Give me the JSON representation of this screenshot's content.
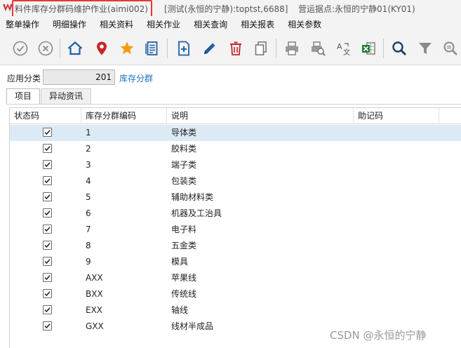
{
  "window": {
    "title": "料件库存分群码维护作业(aimi002)",
    "connection": "[测试(永恒的宁静):toptst,6688]",
    "site": "营运据点:永恒的宁静01(KY01)"
  },
  "menu": {
    "items": [
      {
        "label": "整单操作"
      },
      {
        "label": "明细操作"
      },
      {
        "label": "相关资料"
      },
      {
        "label": "相关作业"
      },
      {
        "label": "相关查询"
      },
      {
        "label": "相关报表"
      },
      {
        "label": "相关参数"
      }
    ]
  },
  "toolbar": {
    "icons": [
      "confirm-icon",
      "cancel-icon",
      "home-icon",
      "location-icon",
      "favorite-icon",
      "list-icon",
      "add-icon",
      "edit-icon",
      "delete-icon",
      "copy-icon",
      "print-icon",
      "print-preview-icon",
      "translate-icon",
      "excel-icon",
      "search-icon",
      "filter-icon",
      "advanced-search-icon"
    ]
  },
  "category": {
    "label": "应用分类",
    "value": "201",
    "link": "库存分群"
  },
  "tabs": [
    {
      "label": "项目",
      "active": true
    },
    {
      "label": "异动资讯",
      "active": false
    }
  ],
  "grid": {
    "columns": [
      "状态码",
      "库存分群编码",
      "说明",
      "助记码"
    ],
    "rows": [
      {
        "checked": true,
        "code": "1",
        "desc": "导体类",
        "mnemonic": ""
      },
      {
        "checked": true,
        "code": "2",
        "desc": "胶料类",
        "mnemonic": ""
      },
      {
        "checked": true,
        "code": "3",
        "desc": "端子类",
        "mnemonic": ""
      },
      {
        "checked": true,
        "code": "4",
        "desc": "包装类",
        "mnemonic": ""
      },
      {
        "checked": true,
        "code": "5",
        "desc": "辅助材料类",
        "mnemonic": ""
      },
      {
        "checked": true,
        "code": "6",
        "desc": "机器及工治具",
        "mnemonic": ""
      },
      {
        "checked": true,
        "code": "7",
        "desc": "电子料",
        "mnemonic": ""
      },
      {
        "checked": true,
        "code": "8",
        "desc": "五金类",
        "mnemonic": ""
      },
      {
        "checked": true,
        "code": "9",
        "desc": "模具",
        "mnemonic": ""
      },
      {
        "checked": true,
        "code": "AXX",
        "desc": "苹果线",
        "mnemonic": ""
      },
      {
        "checked": true,
        "code": "BXX",
        "desc": "传统线",
        "mnemonic": ""
      },
      {
        "checked": true,
        "code": "EXX",
        "desc": "轴线",
        "mnemonic": ""
      },
      {
        "checked": true,
        "code": "GXX",
        "desc": "线材半成品",
        "mnemonic": ""
      }
    ]
  },
  "watermark": "CSDN @永恒的宁静",
  "colors": {
    "accent_red": "#e53935",
    "link_blue": "#1a73c4",
    "selected_row": "#dceaf5"
  }
}
